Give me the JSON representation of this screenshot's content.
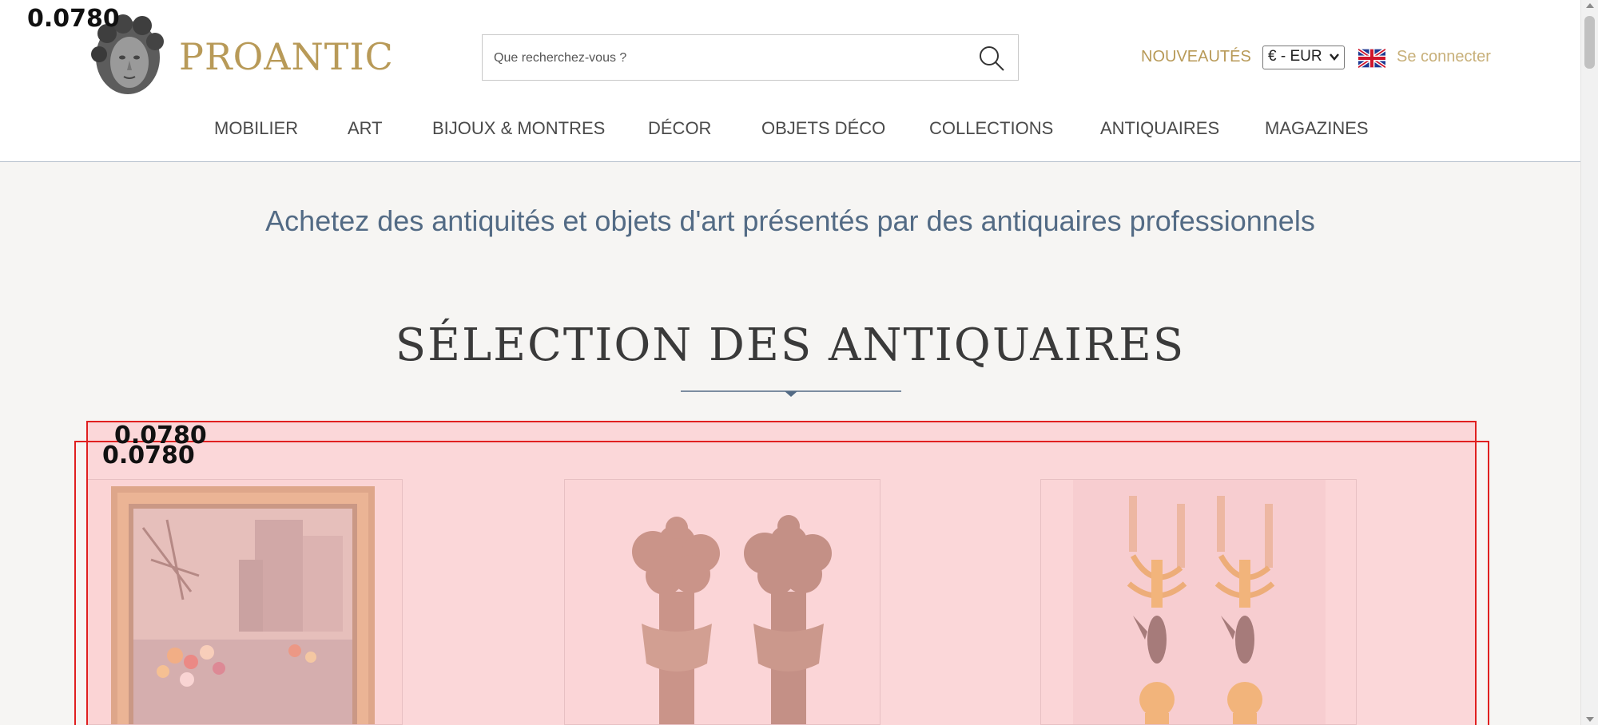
{
  "annotation": {
    "score_label": "0.0780"
  },
  "header": {
    "logo_text": "PROANTIC",
    "search": {
      "placeholder": "Que recherchez-vous ?"
    },
    "new_label": "NOUVEAUTÉS",
    "currency": {
      "selected": "€ - EUR"
    },
    "language_flag": "uk-flag-icon",
    "login_label": "Se connecter",
    "nav": [
      "MOBILIER",
      "ART",
      "BIJOUX & MONTRES",
      "DÉCOR",
      "OBJETS DÉCO",
      "COLLECTIONS",
      "ANTIQUAIRES",
      "MAGAZINES"
    ]
  },
  "main": {
    "tagline": "Achetez des antiquités et objets d'art présentés par des antiquaires professionnels",
    "section_title": "SÉLECTION DES ANTIQUAIRES"
  },
  "colors": {
    "gold": "#b89a58",
    "login_gold": "#c8b07a",
    "tagline_blue": "#536b85",
    "annotation_red": "#e02020",
    "annotation_fill": "#ffbec3"
  }
}
